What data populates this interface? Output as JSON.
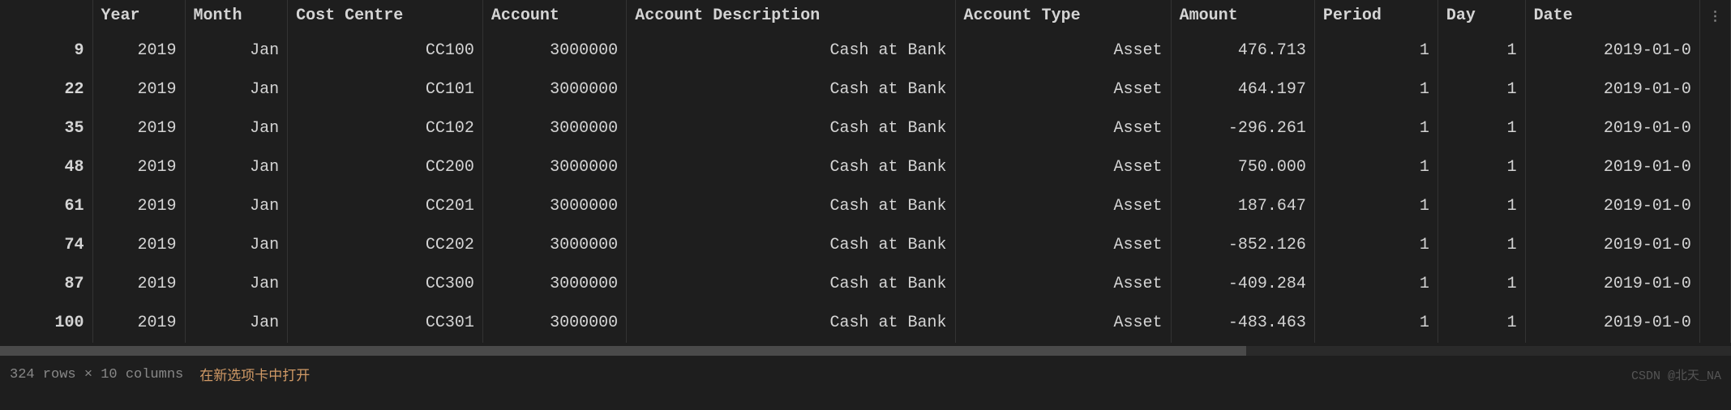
{
  "columns": {
    "index": "",
    "year": "Year",
    "month": "Month",
    "cost_centre": "Cost Centre",
    "account": "Account",
    "account_description": "Account Description",
    "account_type": "Account Type",
    "amount": "Amount",
    "period": "Period",
    "day": "Day",
    "date": "Date"
  },
  "rows": [
    {
      "index": "9",
      "year": "2019",
      "month": "Jan",
      "cost_centre": "CC100",
      "account": "3000000",
      "account_description": "Cash at Bank",
      "account_type": "Asset",
      "amount": "476.713",
      "period": "1",
      "day": "1",
      "date": "2019-01-0"
    },
    {
      "index": "22",
      "year": "2019",
      "month": "Jan",
      "cost_centre": "CC101",
      "account": "3000000",
      "account_description": "Cash at Bank",
      "account_type": "Asset",
      "amount": "464.197",
      "period": "1",
      "day": "1",
      "date": "2019-01-0"
    },
    {
      "index": "35",
      "year": "2019",
      "month": "Jan",
      "cost_centre": "CC102",
      "account": "3000000",
      "account_description": "Cash at Bank",
      "account_type": "Asset",
      "amount": "-296.261",
      "period": "1",
      "day": "1",
      "date": "2019-01-0"
    },
    {
      "index": "48",
      "year": "2019",
      "month": "Jan",
      "cost_centre": "CC200",
      "account": "3000000",
      "account_description": "Cash at Bank",
      "account_type": "Asset",
      "amount": "750.000",
      "period": "1",
      "day": "1",
      "date": "2019-01-0"
    },
    {
      "index": "61",
      "year": "2019",
      "month": "Jan",
      "cost_centre": "CC201",
      "account": "3000000",
      "account_description": "Cash at Bank",
      "account_type": "Asset",
      "amount": "187.647",
      "period": "1",
      "day": "1",
      "date": "2019-01-0"
    },
    {
      "index": "74",
      "year": "2019",
      "month": "Jan",
      "cost_centre": "CC202",
      "account": "3000000",
      "account_description": "Cash at Bank",
      "account_type": "Asset",
      "amount": "-852.126",
      "period": "1",
      "day": "1",
      "date": "2019-01-0"
    },
    {
      "index": "87",
      "year": "2019",
      "month": "Jan",
      "cost_centre": "CC300",
      "account": "3000000",
      "account_description": "Cash at Bank",
      "account_type": "Asset",
      "amount": "-409.284",
      "period": "1",
      "day": "1",
      "date": "2019-01-0"
    },
    {
      "index": "100",
      "year": "2019",
      "month": "Jan",
      "cost_centre": "CC301",
      "account": "3000000",
      "account_description": "Cash at Bank",
      "account_type": "Asset",
      "amount": "-483.463",
      "period": "1",
      "day": "1",
      "date": "2019-01-0"
    }
  ],
  "footer": {
    "summary": "324 rows × 10 columns",
    "open_tab": "在新选项卡中打开",
    "watermark": "CSDN @北天_NA"
  },
  "menu_glyph": "⋮"
}
